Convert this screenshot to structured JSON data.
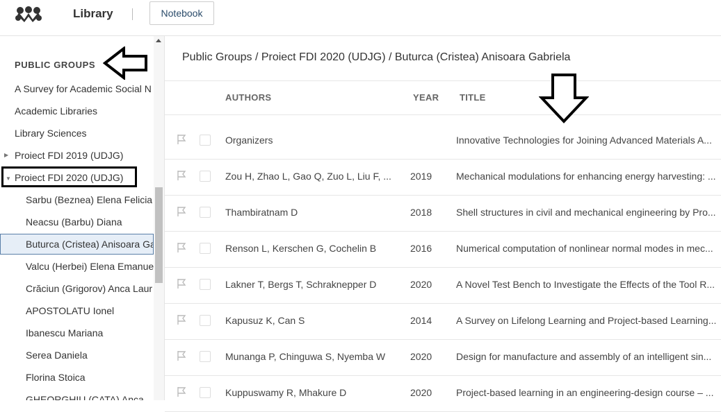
{
  "header": {
    "app_title": "Library",
    "notebook_label": "Notebook",
    "logo_icon": "mendeley-logo-icon"
  },
  "sidebar": {
    "section_title": "PUBLIC GROUPS",
    "groups": [
      {
        "label": "A Survey for Academic Social N"
      },
      {
        "label": "Academic Libraries"
      },
      {
        "label": "Library Sciences"
      },
      {
        "label": "Proiect FDI 2019 (UDJG)",
        "expandable": true,
        "expanded": false
      },
      {
        "label": "Proiect FDI 2020 (UDJG)",
        "expandable": true,
        "expanded": true
      }
    ],
    "children": [
      {
        "label": "Sarbu (Beznea) Elena Felicia"
      },
      {
        "label": "Neacsu (Barbu) Diana"
      },
      {
        "label": "Buturca (Cristea) Anisoara Ga",
        "selected": true
      },
      {
        "label": "Valcu (Herbei) Elena Emanue"
      },
      {
        "label": "Crăciun (Grigorov) Anca Laur"
      },
      {
        "label": "APOSTOLATU Ionel"
      },
      {
        "label": "Ibanescu Mariana"
      },
      {
        "label": "Serea Daniela"
      },
      {
        "label": "Florina Stoica"
      },
      {
        "label": "GHEORGHIU (CATA) Anca"
      }
    ]
  },
  "main": {
    "breadcrumb": "Public Groups / Proiect FDI 2020 (UDJG) / Buturca (Cristea) Anisoara Gabriela",
    "columns": {
      "authors": "AUTHORS",
      "year": "YEAR",
      "title": "TITLE"
    },
    "rows": [
      {
        "authors": "Organizers",
        "year": "",
        "title": "Innovative Technologies for Joining Advanced Materials A..."
      },
      {
        "authors": "Zou H, Zhao L, Gao Q, Zuo L, Liu F, ...",
        "year": "2019",
        "title": "Mechanical modulations for enhancing energy harvesting: ..."
      },
      {
        "authors": "Thambiratnam D",
        "year": "2018",
        "title": "Shell structures in civil and mechanical engineering by Pro..."
      },
      {
        "authors": "Renson L, Kerschen G, Cochelin B",
        "year": "2016",
        "title": "Numerical computation of nonlinear normal modes in mec..."
      },
      {
        "authors": "Lakner T, Bergs T, Schraknepper D",
        "year": "2020",
        "title": "A Novel Test Bench to Investigate the Effects of the Tool R..."
      },
      {
        "authors": "Kapusuz K, Can S",
        "year": "2014",
        "title": "A Survey on Lifelong Learning and Project-based Learning..."
      },
      {
        "authors": "Munanga P, Chinguwa S, Nyemba W",
        "year": "2020",
        "title": "Design for manufacture and assembly of an intelligent sin..."
      },
      {
        "authors": "Kuppuswamy R, Mhakure D",
        "year": "2020",
        "title": "Project-based learning in an engineering-design course – ..."
      }
    ]
  },
  "colors": {
    "accent": "#2a4b6a",
    "selected_bg": "#e6eef7",
    "selected_border": "#5a7fa8",
    "annotation": "#000000"
  }
}
